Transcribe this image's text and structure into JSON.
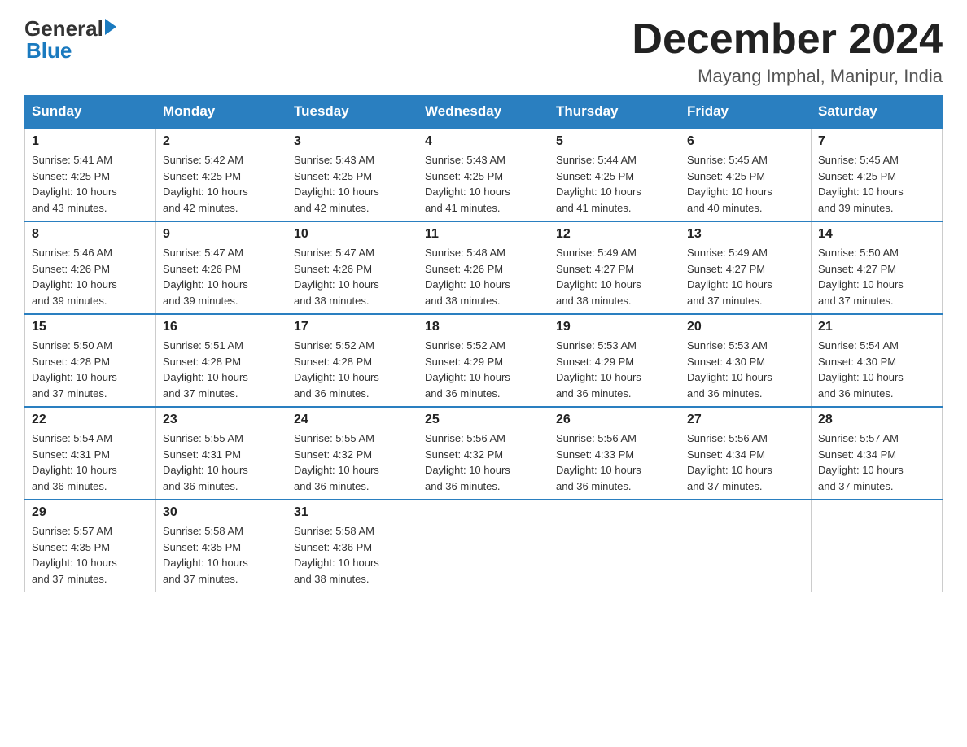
{
  "logo": {
    "text_general": "General",
    "text_blue": "Blue",
    "line2_spaces": ""
  },
  "header": {
    "title": "December 2024",
    "location": "Mayang Imphal, Manipur, India"
  },
  "days_of_week": [
    "Sunday",
    "Monday",
    "Tuesday",
    "Wednesday",
    "Thursday",
    "Friday",
    "Saturday"
  ],
  "weeks": [
    [
      {
        "day": "1",
        "info": "Sunrise: 5:41 AM\nSunset: 4:25 PM\nDaylight: 10 hours\nand 43 minutes."
      },
      {
        "day": "2",
        "info": "Sunrise: 5:42 AM\nSunset: 4:25 PM\nDaylight: 10 hours\nand 42 minutes."
      },
      {
        "day": "3",
        "info": "Sunrise: 5:43 AM\nSunset: 4:25 PM\nDaylight: 10 hours\nand 42 minutes."
      },
      {
        "day": "4",
        "info": "Sunrise: 5:43 AM\nSunset: 4:25 PM\nDaylight: 10 hours\nand 41 minutes."
      },
      {
        "day": "5",
        "info": "Sunrise: 5:44 AM\nSunset: 4:25 PM\nDaylight: 10 hours\nand 41 minutes."
      },
      {
        "day": "6",
        "info": "Sunrise: 5:45 AM\nSunset: 4:25 PM\nDaylight: 10 hours\nand 40 minutes."
      },
      {
        "day": "7",
        "info": "Sunrise: 5:45 AM\nSunset: 4:25 PM\nDaylight: 10 hours\nand 39 minutes."
      }
    ],
    [
      {
        "day": "8",
        "info": "Sunrise: 5:46 AM\nSunset: 4:26 PM\nDaylight: 10 hours\nand 39 minutes."
      },
      {
        "day": "9",
        "info": "Sunrise: 5:47 AM\nSunset: 4:26 PM\nDaylight: 10 hours\nand 39 minutes."
      },
      {
        "day": "10",
        "info": "Sunrise: 5:47 AM\nSunset: 4:26 PM\nDaylight: 10 hours\nand 38 minutes."
      },
      {
        "day": "11",
        "info": "Sunrise: 5:48 AM\nSunset: 4:26 PM\nDaylight: 10 hours\nand 38 minutes."
      },
      {
        "day": "12",
        "info": "Sunrise: 5:49 AM\nSunset: 4:27 PM\nDaylight: 10 hours\nand 38 minutes."
      },
      {
        "day": "13",
        "info": "Sunrise: 5:49 AM\nSunset: 4:27 PM\nDaylight: 10 hours\nand 37 minutes."
      },
      {
        "day": "14",
        "info": "Sunrise: 5:50 AM\nSunset: 4:27 PM\nDaylight: 10 hours\nand 37 minutes."
      }
    ],
    [
      {
        "day": "15",
        "info": "Sunrise: 5:50 AM\nSunset: 4:28 PM\nDaylight: 10 hours\nand 37 minutes."
      },
      {
        "day": "16",
        "info": "Sunrise: 5:51 AM\nSunset: 4:28 PM\nDaylight: 10 hours\nand 37 minutes."
      },
      {
        "day": "17",
        "info": "Sunrise: 5:52 AM\nSunset: 4:28 PM\nDaylight: 10 hours\nand 36 minutes."
      },
      {
        "day": "18",
        "info": "Sunrise: 5:52 AM\nSunset: 4:29 PM\nDaylight: 10 hours\nand 36 minutes."
      },
      {
        "day": "19",
        "info": "Sunrise: 5:53 AM\nSunset: 4:29 PM\nDaylight: 10 hours\nand 36 minutes."
      },
      {
        "day": "20",
        "info": "Sunrise: 5:53 AM\nSunset: 4:30 PM\nDaylight: 10 hours\nand 36 minutes."
      },
      {
        "day": "21",
        "info": "Sunrise: 5:54 AM\nSunset: 4:30 PM\nDaylight: 10 hours\nand 36 minutes."
      }
    ],
    [
      {
        "day": "22",
        "info": "Sunrise: 5:54 AM\nSunset: 4:31 PM\nDaylight: 10 hours\nand 36 minutes."
      },
      {
        "day": "23",
        "info": "Sunrise: 5:55 AM\nSunset: 4:31 PM\nDaylight: 10 hours\nand 36 minutes."
      },
      {
        "day": "24",
        "info": "Sunrise: 5:55 AM\nSunset: 4:32 PM\nDaylight: 10 hours\nand 36 minutes."
      },
      {
        "day": "25",
        "info": "Sunrise: 5:56 AM\nSunset: 4:32 PM\nDaylight: 10 hours\nand 36 minutes."
      },
      {
        "day": "26",
        "info": "Sunrise: 5:56 AM\nSunset: 4:33 PM\nDaylight: 10 hours\nand 36 minutes."
      },
      {
        "day": "27",
        "info": "Sunrise: 5:56 AM\nSunset: 4:34 PM\nDaylight: 10 hours\nand 37 minutes."
      },
      {
        "day": "28",
        "info": "Sunrise: 5:57 AM\nSunset: 4:34 PM\nDaylight: 10 hours\nand 37 minutes."
      }
    ],
    [
      {
        "day": "29",
        "info": "Sunrise: 5:57 AM\nSunset: 4:35 PM\nDaylight: 10 hours\nand 37 minutes."
      },
      {
        "day": "30",
        "info": "Sunrise: 5:58 AM\nSunset: 4:35 PM\nDaylight: 10 hours\nand 37 minutes."
      },
      {
        "day": "31",
        "info": "Sunrise: 5:58 AM\nSunset: 4:36 PM\nDaylight: 10 hours\nand 38 minutes."
      },
      null,
      null,
      null,
      null
    ]
  ]
}
